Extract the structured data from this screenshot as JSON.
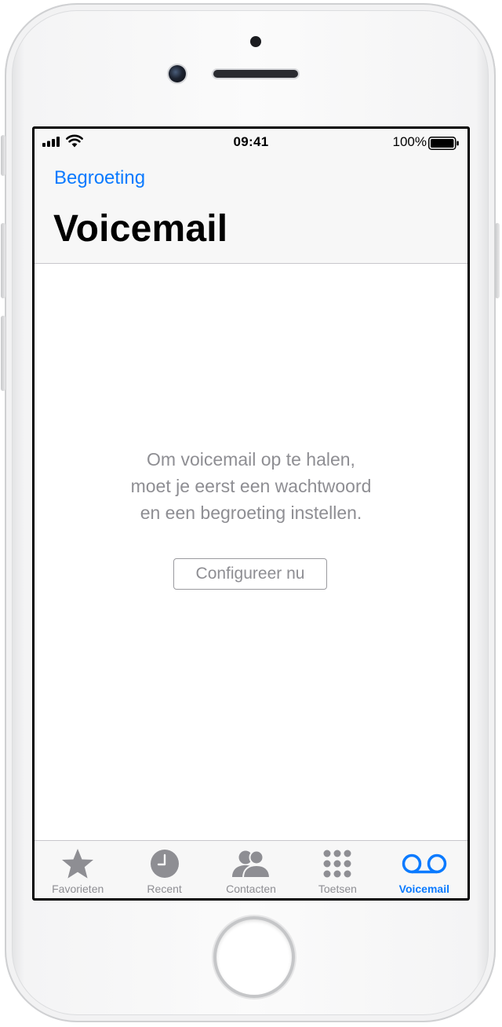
{
  "status_bar": {
    "time": "09:41",
    "battery_percent": "100%"
  },
  "nav": {
    "back_label": "Begroeting",
    "title": "Voicemail"
  },
  "empty_state": {
    "lines": [
      "Om voicemail op te halen,",
      "moet je eerst een wachtwoord",
      "en een begroeting instellen."
    ],
    "button_label": "Configureer nu"
  },
  "tab_bar": {
    "tabs": [
      {
        "label": "Favorieten",
        "icon": "star-icon",
        "active": false
      },
      {
        "label": "Recent",
        "icon": "clock-icon",
        "active": false
      },
      {
        "label": "Contacten",
        "icon": "contacts-icon",
        "active": false
      },
      {
        "label": "Toetsen",
        "icon": "keypad-icon",
        "active": false
      },
      {
        "label": "Voicemail",
        "icon": "voicemail-icon",
        "active": true
      }
    ]
  },
  "colors": {
    "accent": "#0a7aff",
    "inactive": "#8e8e93",
    "bar_background": "#f7f7f7"
  }
}
